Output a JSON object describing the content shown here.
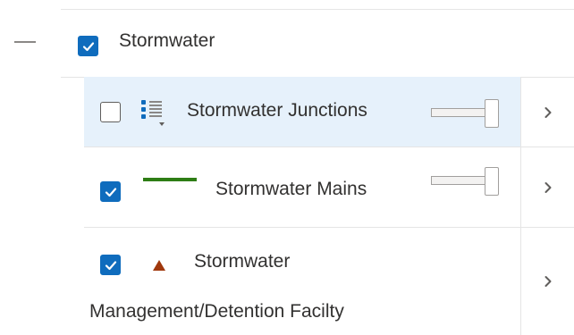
{
  "group": {
    "label": "Stormwater",
    "checked": true,
    "expanded": true
  },
  "layers": [
    {
      "label": "Stormwater Junctions",
      "checked": false,
      "selected": true,
      "symbol": "list-icon"
    },
    {
      "label": "Stormwater Mains",
      "checked": true,
      "selected": false,
      "symbol": "line-symbol",
      "symbol_color": "#2e7d15"
    },
    {
      "label_line1": "Stormwater",
      "label_line2": "Management/Detention Facilty",
      "checked": true,
      "selected": false,
      "symbol": "triangle-symbol",
      "symbol_color": "#a0380c"
    }
  ],
  "colors": {
    "accent": "#0f6cbd",
    "selected_row": "#e6f1fb"
  }
}
